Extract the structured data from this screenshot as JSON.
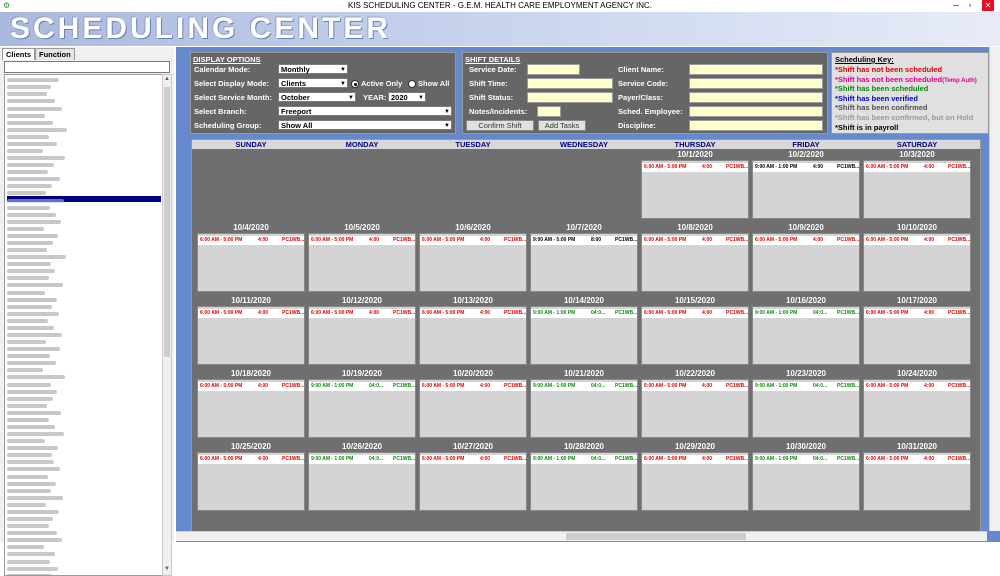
{
  "window": {
    "title": "KIS SCHEDULING CENTER - G.E.M. HEALTH CARE EMPLOYMENT AGENCY INC.",
    "minimize": "─",
    "maximize": "▫",
    "close": "✕"
  },
  "banner": {
    "text": "SCHEDULING CENTER"
  },
  "left": {
    "tabs": [
      "Clients",
      "Function"
    ],
    "active_tab": 0,
    "client_search_value": "",
    "client_count": 72,
    "selected_index": 17,
    "names_note_hidden": true
  },
  "display_options": {
    "title": "DISPLAY OPTIONS",
    "calendar_mode_label": "Calendar Mode:",
    "calendar_mode_value": "Monthly",
    "display_mode_label": "Select Display Mode:",
    "display_mode_value": "Clients",
    "active_only_label": "Active Only",
    "show_all_label": "Show All",
    "service_month_label": "Select Service Month:",
    "service_month_value": "October",
    "year_label": "YEAR:",
    "year_value": "2020",
    "branch_label": "Select Branch:",
    "branch_value": "Freeport",
    "group_label": "Scheduling Group:",
    "group_value": "Show All"
  },
  "shift_details": {
    "title": "SHIFT DETAILS",
    "service_date": "Service Date:",
    "shift_time": "Shift Time:",
    "shift_status": "Shift Status:",
    "notes": "Notes/Incidents:",
    "client_name": "Client Name:",
    "service_code": "Service Code:",
    "payer_class": "Payer/Class:",
    "sched_employee": "Sched. Employee:",
    "discipline": "Discipline:",
    "confirm_button": "Confirm Shift",
    "add_tasks_button": "Add Tasks"
  },
  "scheduling_key": {
    "title": "Scheduling Key:",
    "lines": [
      {
        "text": "*Shift has not been scheduled",
        "extra": "",
        "color": "#e00000"
      },
      {
        "text": "*Shift has not been scheduled",
        "extra": "(Temp Auth)",
        "color": "#e0008a"
      },
      {
        "text": "*Shift has been scheduled",
        "extra": "",
        "color": "#0a8a0a"
      },
      {
        "text": "*Shift has been verified",
        "extra": "",
        "color": "#0000cc"
      },
      {
        "text": "*Shift has been confirmed",
        "extra": "",
        "color": "#505050"
      },
      {
        "text": "*Shift has been confirmed, but on Hold",
        "extra": "",
        "color": "#9a9a9a"
      },
      {
        "text": "*Shift is in payroll",
        "extra": "",
        "color": "#000000"
      }
    ]
  },
  "calendar": {
    "days_of_week": [
      "SUNDAY",
      "MONDAY",
      "TUESDAY",
      "WEDNESDAY",
      "THURSDAY",
      "FRIDAY",
      "SATURDAY"
    ],
    "weeks": [
      [
        null,
        null,
        null,
        null,
        {
          "date": "10/1/2020",
          "time": "6:00 AM - 5:00 PM",
          "hours": "4:00",
          "code": "PC1WB...",
          "status": "red"
        },
        {
          "date": "10/2/2020",
          "time": "9:00 AM - 1:00 PM",
          "hours": "4:00",
          "code": "PC1WB...",
          "status": "black"
        },
        {
          "date": "10/3/2020",
          "time": "6:00 AM - 5:00 PM",
          "hours": "4:00",
          "code": "PC1WB...",
          "status": "red"
        }
      ],
      [
        {
          "date": "10/4/2020",
          "time": "6:00 AM - 5:00 PM",
          "hours": "4:00",
          "code": "PC1WB...",
          "status": "red"
        },
        {
          "date": "10/5/2020",
          "time": "6:00 AM - 5:00 PM",
          "hours": "4:00",
          "code": "PC1WB...",
          "status": "red"
        },
        {
          "date": "10/6/2020",
          "time": "6:00 AM - 5:00 PM",
          "hours": "4:00",
          "code": "PC1WB...",
          "status": "red"
        },
        {
          "date": "10/7/2020",
          "time": "9:00 AM - 5:00 PM",
          "hours": "8:00",
          "code": "PC1WB...",
          "status": "black"
        },
        {
          "date": "10/8/2020",
          "time": "6:00 AM - 5:00 PM",
          "hours": "4:00",
          "code": "PC1WB...",
          "status": "red"
        },
        {
          "date": "10/9/2020",
          "time": "6:00 AM - 5:00 PM",
          "hours": "4:00",
          "code": "PC1WB...",
          "status": "red"
        },
        {
          "date": "10/10/2020",
          "time": "6:00 AM - 5:00 PM",
          "hours": "4:00",
          "code": "PC1WB...",
          "status": "red"
        }
      ],
      [
        {
          "date": "10/11/2020",
          "time": "6:00 AM - 5:00 PM",
          "hours": "4:00",
          "code": "PC1WB...",
          "status": "red"
        },
        {
          "date": "10/12/2020",
          "time": "6:00 AM - 5:00 PM",
          "hours": "4:00",
          "code": "PC1WB...",
          "status": "red"
        },
        {
          "date": "10/13/2020",
          "time": "6:00 AM - 5:00 PM",
          "hours": "4:00",
          "code": "PC1WB...",
          "status": "red"
        },
        {
          "date": "10/14/2020",
          "time": "9:00 AM - 1:00 PM",
          "hours": "04:0...",
          "code": "PC1WB...",
          "status": "green"
        },
        {
          "date": "10/15/2020",
          "time": "6:00 AM - 5:00 PM",
          "hours": "4:00",
          "code": "PC1WB...",
          "status": "red"
        },
        {
          "date": "10/16/2020",
          "time": "9:00 AM - 1:00 PM",
          "hours": "04:0...",
          "code": "PC1WB...",
          "status": "green"
        },
        {
          "date": "10/17/2020",
          "time": "6:00 AM - 5:00 PM",
          "hours": "4:00",
          "code": "PC1WB...",
          "status": "red"
        }
      ],
      [
        {
          "date": "10/18/2020",
          "time": "6:00 AM - 5:00 PM",
          "hours": "4:00",
          "code": "PC1WB...",
          "status": "red"
        },
        {
          "date": "10/19/2020",
          "time": "9:00 AM - 1:00 PM",
          "hours": "04:0...",
          "code": "PC1WB...",
          "status": "green"
        },
        {
          "date": "10/20/2020",
          "time": "6:00 AM - 5:00 PM",
          "hours": "4:00",
          "code": "PC1WB...",
          "status": "red"
        },
        {
          "date": "10/21/2020",
          "time": "9:00 AM - 1:00 PM",
          "hours": "04:0...",
          "code": "PC1WB...",
          "status": "green"
        },
        {
          "date": "10/22/2020",
          "time": "6:00 AM - 5:00 PM",
          "hours": "4:00",
          "code": "PC1WB...",
          "status": "red"
        },
        {
          "date": "10/23/2020",
          "time": "9:00 AM - 1:00 PM",
          "hours": "04:0...",
          "code": "PC1WB...",
          "status": "green"
        },
        {
          "date": "10/24/2020",
          "time": "6:00 AM - 5:00 PM",
          "hours": "4:00",
          "code": "PC1WB...",
          "status": "red"
        }
      ],
      [
        {
          "date": "10/25/2020",
          "time": "6:00 AM - 5:00 PM",
          "hours": "4:00",
          "code": "PC1WB...",
          "status": "red"
        },
        {
          "date": "10/26/2020",
          "time": "9:00 AM - 1:00 PM",
          "hours": "04:0...",
          "code": "PC1WB...",
          "status": "green"
        },
        {
          "date": "10/27/2020",
          "time": "6:00 AM - 5:00 PM",
          "hours": "4:00",
          "code": "PC1WB...",
          "status": "red"
        },
        {
          "date": "10/28/2020",
          "time": "9:00 AM - 1:00 PM",
          "hours": "04:0...",
          "code": "PC1WB...",
          "status": "green"
        },
        {
          "date": "10/29/2020",
          "time": "6:00 AM - 5:00 PM",
          "hours": "4:00",
          "code": "PC1WB...",
          "status": "red"
        },
        {
          "date": "10/30/2020",
          "time": "9:00 AM - 1:00 PM",
          "hours": "04:0...",
          "code": "PC1WB...",
          "status": "green"
        },
        {
          "date": "10/31/2020",
          "time": "6:00 AM - 5:00 PM",
          "hours": "4:00",
          "code": "PC1WB...",
          "status": "red"
        }
      ]
    ]
  }
}
